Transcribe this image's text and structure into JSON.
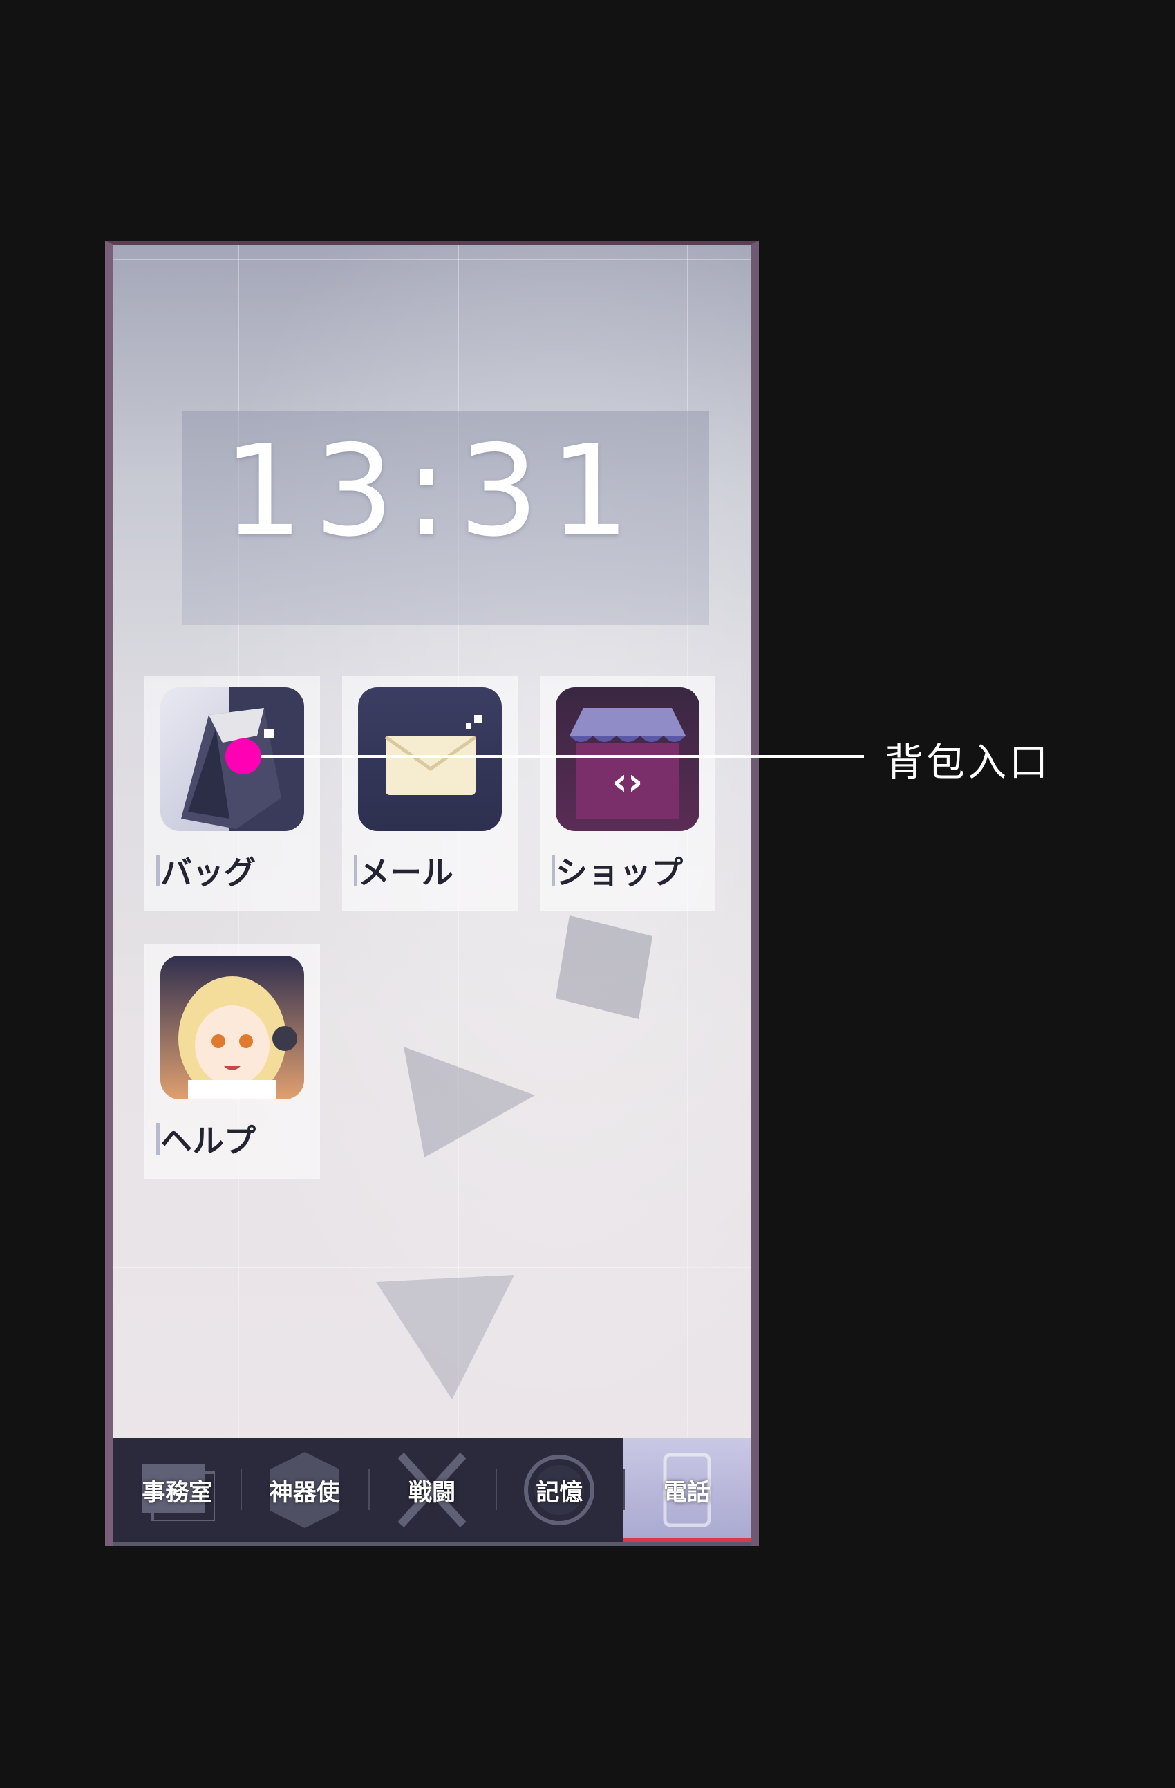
{
  "clock": {
    "time": "13:31"
  },
  "apps": [
    {
      "label": "バッグ",
      "icon": "bag-icon"
    },
    {
      "label": "メール",
      "icon": "mail-icon"
    },
    {
      "label": "ショップ",
      "icon": "shop-icon"
    },
    {
      "label": "ヘルプ",
      "icon": "help-character-icon"
    }
  ],
  "tabbar": {
    "tabs": [
      {
        "label": "事務室"
      },
      {
        "label": "神器使"
      },
      {
        "label": "戦闘"
      },
      {
        "label": "記憶"
      },
      {
        "label": "電話",
        "active": true
      }
    ]
  },
  "annotation": {
    "label": "背包入口",
    "color": "#ff00b4"
  }
}
